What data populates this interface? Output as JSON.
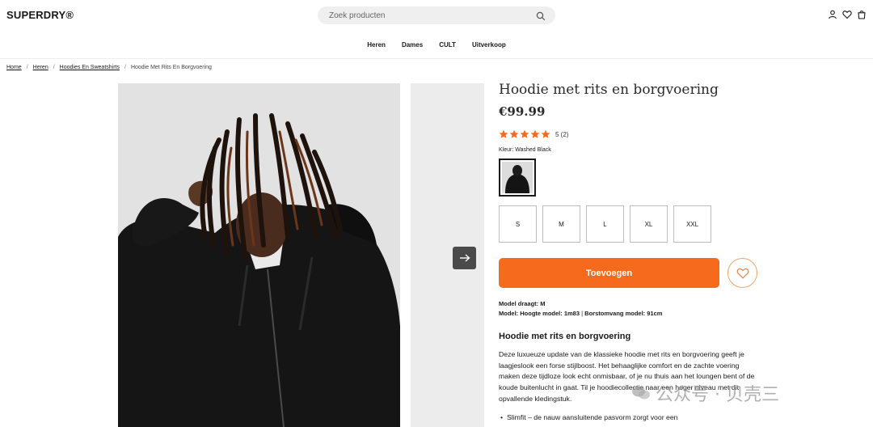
{
  "header": {
    "logo": "SUPERDRY®",
    "search_placeholder": "Zoek producten",
    "icons": [
      "user-icon",
      "heart-icon",
      "bag-icon"
    ]
  },
  "nav": {
    "items": [
      "Heren",
      "Dames",
      "CULT",
      "Uitverkoop"
    ]
  },
  "breadcrumb": {
    "items": [
      "Home",
      "Heren",
      "Hoodies En Sweatshirts",
      "Hoodie Met Rits En Borgvoering"
    ]
  },
  "gallery": {
    "next_icon": "arrow-right-icon"
  },
  "product": {
    "title": "Hoodie met rits en borgvoering",
    "price": "€99.99",
    "rating": {
      "stars": 5,
      "text": "5 (2)"
    },
    "colour_label": "Kleur:",
    "colour_value": "Washed Black",
    "sizes": [
      "S",
      "M",
      "L",
      "XL",
      "XXL"
    ],
    "add_label": "Toevoegen",
    "model_wears_label": "Model draagt:",
    "model_wears_value": "M",
    "model_height_label": "Model: Hoogte model:",
    "model_height_value": "1m83",
    "model_chest_label": "Borstomvang model:",
    "model_chest_value": "91cm",
    "desc_title": "Hoodie met rits en borgvoering",
    "desc_body": "Deze luxueuze update van de klassieke hoodie met rits en borgvoering geeft je laagjeslook een forse stijlboost. Het behaaglijke comfort en de zachte voering maken deze tijdloze look echt onmisbaar, of je nu thuis aan het loungen bent of de koude buitenlucht in gaat. Til je hoodiecollectie naar een hoger niveau met dit opvallende kledingstuk.",
    "bullet_1": "Slimfit – de nauw aansluitende pasvorm zorgt voor een"
  },
  "colors": {
    "accent": "#f56a1c",
    "star": "#f56a1c",
    "wish_border": "#e8a574"
  },
  "watermark": {
    "text": "公众号 · 贝壳三"
  }
}
